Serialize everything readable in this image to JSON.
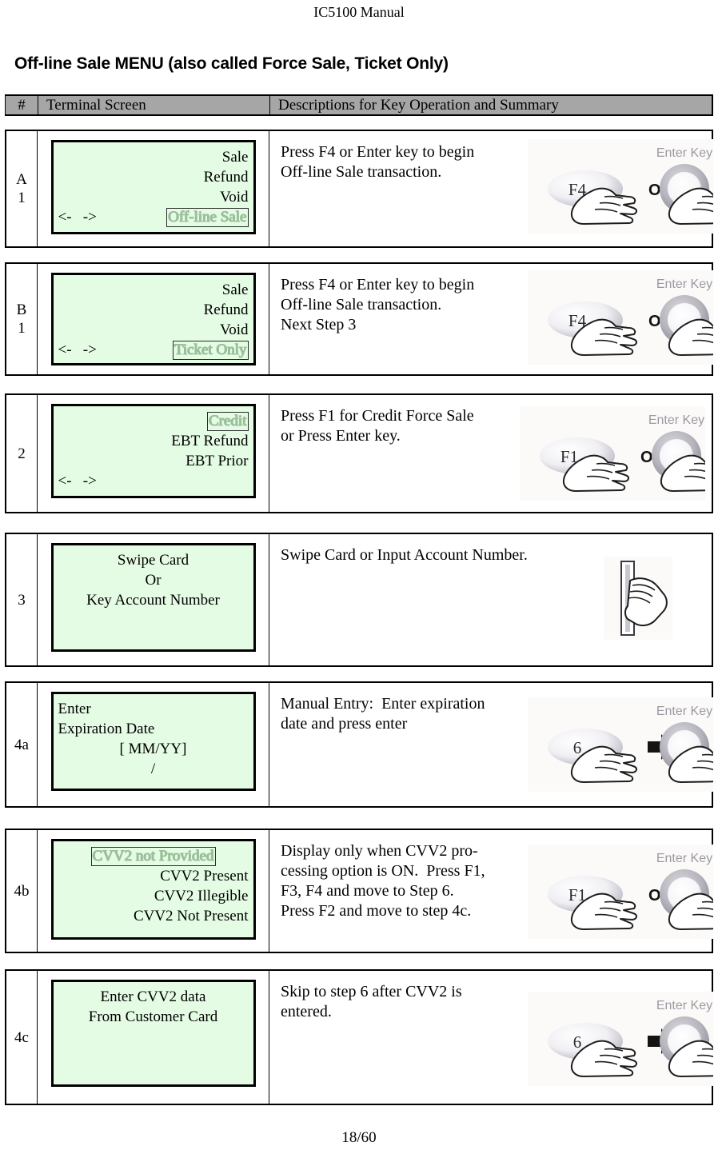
{
  "document": {
    "running_head": "IC5100 Manual",
    "section_title": "Off-line Sale MENU (also called Force Sale, Ticket Only)",
    "page_number": "18/60"
  },
  "colors": {
    "lcd_background": "#e4fbe4",
    "header_background": "#a6a6a6",
    "border": "#000000",
    "hollow_text": "#9bbf9b"
  },
  "table": {
    "headers": {
      "number": "#",
      "screen": "Terminal Screen",
      "description": "Descriptions for Key Operation and Summary"
    },
    "rows": [
      {
        "id": "A1",
        "label_lines": [
          "A",
          "1"
        ],
        "screen": {
          "lines": [
            {
              "text": "Sale",
              "align": "right",
              "style": "normal"
            },
            {
              "text": "Refund",
              "align": "right",
              "style": "normal"
            },
            {
              "text": "Void",
              "align": "right",
              "style": "normal"
            }
          ],
          "nav_left": "<-   ->",
          "nav_right": "Off-line Sale",
          "nav_right_style": "hollow"
        },
        "description_lines": [
          "Press F4 or Enter key to begin",
          "Off-line Sale transaction."
        ],
        "illustration": {
          "type": "key-or-enter",
          "key_label": "F4",
          "connector": "OR",
          "enter_label": "Enter Key"
        }
      },
      {
        "id": "B1",
        "label_lines": [
          "B",
          "1"
        ],
        "screen": {
          "lines": [
            {
              "text": "Sale",
              "align": "right",
              "style": "normal"
            },
            {
              "text": "Refund",
              "align": "right",
              "style": "normal"
            },
            {
              "text": "Void",
              "align": "right",
              "style": "normal"
            }
          ],
          "nav_left": "<-   ->",
          "nav_right": "Ticket Only",
          "nav_right_style": "hollow"
        },
        "description_lines": [
          "Press F4 or Enter key to begin",
          "Off-line Sale transaction.",
          "Next Step 3"
        ],
        "illustration": {
          "type": "key-or-enter",
          "key_label": "F4",
          "connector": "OR",
          "enter_label": "Enter Key"
        }
      },
      {
        "id": "2",
        "label_lines": [
          "2"
        ],
        "screen": {
          "lines": [
            {
              "text": "Credit",
              "align": "right",
              "style": "hollow"
            },
            {
              "text": "EBT Refund",
              "align": "right",
              "style": "normal"
            },
            {
              "text": "EBT Prior",
              "align": "right",
              "style": "normal"
            }
          ],
          "nav_left": "<-   ->",
          "nav_right": "",
          "nav_right_style": "none"
        },
        "description_lines": [
          "Press F1 for Credit Force Sale",
          "or Press Enter key."
        ],
        "illustration": {
          "type": "key-or-enter",
          "key_label": "F1",
          "connector": "OR",
          "enter_label": "Enter Key"
        }
      },
      {
        "id": "3",
        "label_lines": [
          "3"
        ],
        "screen": {
          "lines": [
            {
              "text": "Swipe Card",
              "align": "center",
              "style": "normal"
            },
            {
              "text": "Or",
              "align": "center",
              "style": "normal"
            },
            {
              "text": "Key Account Number",
              "align": "center",
              "style": "normal"
            }
          ],
          "nav_left": "",
          "nav_right": "",
          "nav_right_style": "none"
        },
        "description_lines": [
          "Swipe Card or Input Account Number."
        ],
        "illustration": {
          "type": "swipe-card-hand"
        }
      },
      {
        "id": "4a",
        "label_lines": [
          "4a"
        ],
        "screen": {
          "lines": [
            {
              "text": "Enter",
              "align": "left",
              "style": "normal"
            },
            {
              "text": "Expiration Date",
              "align": "left",
              "style": "normal"
            },
            {
              "text": "[ MM/YY]",
              "align": "center",
              "style": "normal"
            },
            {
              "text": "/",
              "align": "center",
              "style": "normal"
            }
          ],
          "nav_left": "",
          "nav_right": "",
          "nav_right_style": "none"
        },
        "description_lines": [
          "Manual Entry:  Enter expiration",
          "date and press enter"
        ],
        "illustration": {
          "type": "key-then-enter",
          "key_label": "6",
          "connector": "arrow",
          "enter_label": "Enter Key"
        }
      },
      {
        "id": "4b",
        "label_lines": [
          "4b"
        ],
        "screen": {
          "lines": [
            {
              "text": "CVV2 not Provided",
              "align": "center",
              "style": "hollow"
            },
            {
              "text": "CVV2 Present",
              "align": "right",
              "style": "normal"
            },
            {
              "text": "CVV2 Illegible",
              "align": "right",
              "style": "normal"
            },
            {
              "text": "CVV2 Not Present",
              "align": "right",
              "style": "normal"
            }
          ],
          "nav_left": "",
          "nav_right": "",
          "nav_right_style": "none"
        },
        "description_lines": [
          "Display only when CVV2 pro-",
          "cessing option is ON.  Press F1,",
          "F3, F4 and move to Step 6.",
          "Press F2 and move to step 4c."
        ],
        "illustration": {
          "type": "key-or-enter",
          "key_label": "F1",
          "connector": "OR",
          "enter_label": "Enter Key"
        }
      },
      {
        "id": "4c",
        "label_lines": [
          "4c"
        ],
        "screen": {
          "lines": [
            {
              "text": "Enter CVV2 data",
              "align": "center",
              "style": "normal"
            },
            {
              "text": "From Customer Card",
              "align": "center",
              "style": "normal"
            }
          ],
          "nav_left": "",
          "nav_right": "",
          "nav_right_style": "none"
        },
        "description_lines": [
          "Skip to step 6 after CVV2 is",
          "entered."
        ],
        "illustration": {
          "type": "key-then-enter",
          "key_label": "6",
          "connector": "arrow",
          "enter_label": "Enter Key"
        }
      }
    ]
  }
}
